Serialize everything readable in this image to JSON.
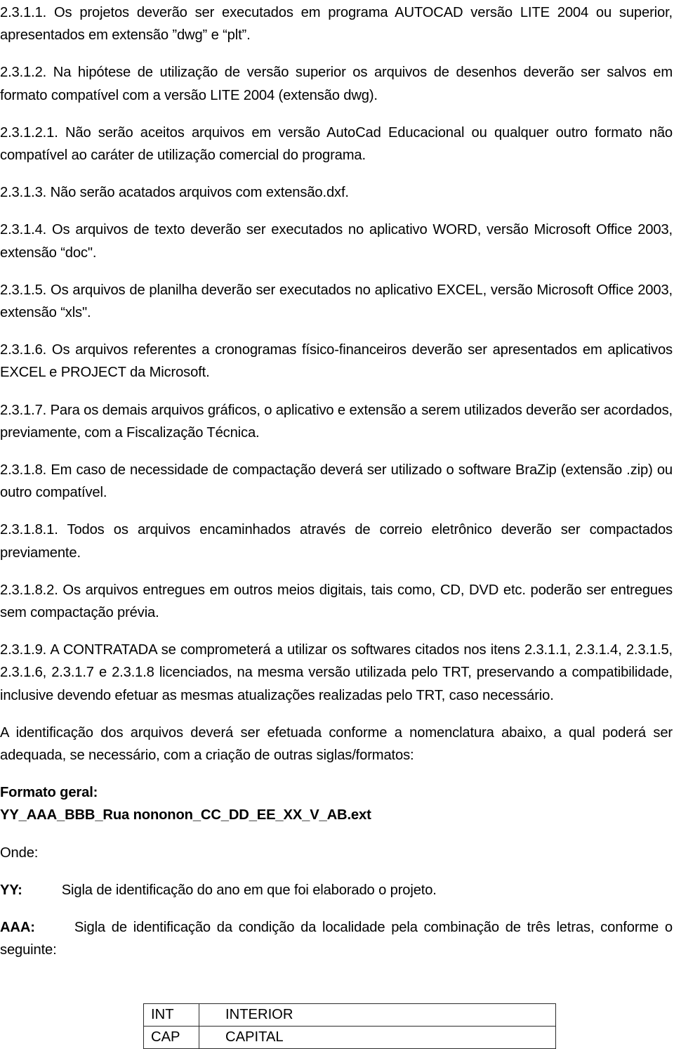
{
  "document": {
    "language": "pt-BR",
    "paragraphs": [
      {
        "id": "p-2-3-1-1",
        "text": "2.3.1.1. Os projetos deverão ser executados em programa AUTOCAD versão LITE 2004 ou superior, apresentados em extensão ”dwg” e “plt”."
      },
      {
        "id": "p-2-3-1-2",
        "text": "2.3.1.2. Na hipótese de utilização de versão superior os arquivos de desenhos deverão ser salvos em formato compatível com a versão LITE 2004 (extensão dwg)."
      },
      {
        "id": "p-2-3-1-2-1",
        "text": "2.3.1.2.1. Não serão aceitos arquivos em versão AutoCad Educacional ou qualquer outro formato não compatível ao caráter de utilização comercial do programa."
      },
      {
        "id": "p-2-3-1-3",
        "text": "2.3.1.3. Não serão acatados arquivos com extensão.dxf."
      },
      {
        "id": "p-2-3-1-4",
        "text": "2.3.1.4. Os arquivos de texto deverão ser executados no aplicativo WORD, versão Microsoft Office 2003, extensão “doc\"."
      },
      {
        "id": "p-2-3-1-5",
        "text": "2.3.1.5. Os arquivos de planilha deverão ser executados no aplicativo EXCEL, versão Microsoft Office 2003, extensão “xls\"."
      },
      {
        "id": "p-2-3-1-6",
        "text": "2.3.1.6. Os arquivos referentes a cronogramas físico-financeiros deverão ser apresentados em aplicativos EXCEL e PROJECT da Microsoft."
      },
      {
        "id": "p-2-3-1-7",
        "text": "2.3.1.7. Para os demais arquivos gráficos, o aplicativo e extensão a serem utilizados deverão ser acordados, previamente, com a Fiscalização Técnica."
      },
      {
        "id": "p-2-3-1-8",
        "text": "2.3.1.8. Em caso de necessidade de compactação deverá ser utilizado o software BraZip (extensão .zip) ou outro compatível."
      },
      {
        "id": "p-2-3-1-8-1",
        "text": "2.3.1.8.1. Todos os arquivos encaminhados através de correio eletrônico deverão ser compactados previamente."
      },
      {
        "id": "p-2-3-1-8-2",
        "text": "2.3.1.8.2. Os arquivos entregues em outros meios digitais, tais como, CD, DVD etc. poderão ser entregues sem compactação prévia."
      },
      {
        "id": "p-2-3-1-9",
        "text": "2.3.1.9. A CONTRATADA se comprometerá a utilizar os softwares citados nos itens 2.3.1.1, 2.3.1.4, 2.3.1.5, 2.3.1.6, 2.3.1.7 e 2.3.1.8 licenciados, na mesma versão utilizada pelo TRT, preservando a compatibilidade, inclusive devendo efetuar as mesmas atualizações realizadas pelo TRT, caso necessário."
      },
      {
        "id": "p-identificacao",
        "text": "A identificação dos arquivos deverá ser efetuada conforme a nomenclatura abaixo, a qual poderá ser adequada, se necessário, com a criação de outras siglas/formatos:"
      }
    ],
    "formato_geral": {
      "label": "Formato geral:",
      "pattern": "YY_AAA_BBB_Rua nononon_CC_DD_EE_XX_V_AB.ext"
    },
    "onde": {
      "label": "Onde:",
      "entries": [
        {
          "key": "YY:",
          "description": "Sigla de identificação do ano em que foi elaborado o projeto."
        },
        {
          "key": "AAA:",
          "description": "Sigla de identificação da condição da localidade pela combinação de três letras, conforme o seguinte:"
        }
      ]
    },
    "sigla_table": {
      "rows": [
        {
          "sigla": "INT",
          "descricao": "INTERIOR"
        },
        {
          "sigla": "CAP",
          "descricao": "CAPITAL"
        }
      ]
    }
  }
}
